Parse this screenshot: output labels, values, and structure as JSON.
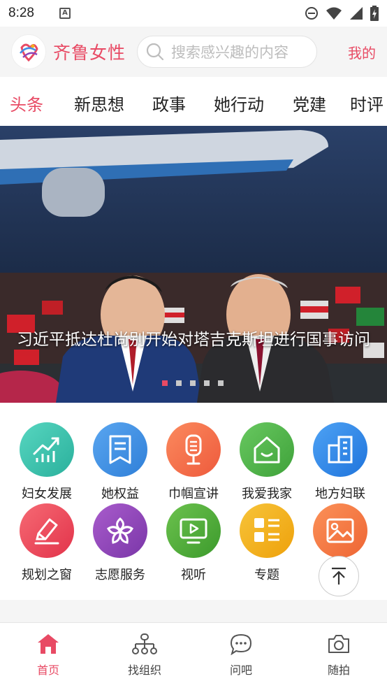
{
  "status_bar": {
    "time": "8:28",
    "notification_icon": "a-letter-icon",
    "right_icons": [
      "do-not-disturb-icon",
      "wifi-icon",
      "signal-icon",
      "battery-charging-icon"
    ]
  },
  "header": {
    "logo_icon": "qilu-women-logo",
    "brand": "齐鲁女性",
    "search_placeholder": "搜索感兴趣的内容",
    "mine_label": "我的"
  },
  "tabs": [
    {
      "label": "头条",
      "active": true
    },
    {
      "label": "新思想",
      "active": false
    },
    {
      "label": "政事",
      "active": false
    },
    {
      "label": "她行动",
      "active": false
    },
    {
      "label": "党建",
      "active": false
    },
    {
      "label": "时评",
      "active": false
    }
  ],
  "banner": {
    "caption": "习近平抵达杜尚别开始对塔吉克斯坦进行国事访问",
    "slide_count": 5,
    "active_slide": 1
  },
  "grid": [
    {
      "label": "妇女发展",
      "icon": "chart-growth-icon",
      "color": "#3cc6b0"
    },
    {
      "label": "她权益",
      "icon": "document-icon",
      "color": "#3f8fe6"
    },
    {
      "label": "巾帼宣讲",
      "icon": "microphone-icon",
      "color": "#f4734d"
    },
    {
      "label": "我爱我家",
      "icon": "home-icon",
      "color": "#52b84d"
    },
    {
      "label": "地方妇联",
      "icon": "building-icon",
      "color": "#2f84e8"
    },
    {
      "label": "规划之窗",
      "icon": "pen-edit-icon",
      "color": "#ee4e5e"
    },
    {
      "label": "志愿服务",
      "icon": "flower-icon",
      "color": "#8d45b8"
    },
    {
      "label": "视听",
      "icon": "video-play-icon",
      "color": "#55b53c"
    },
    {
      "label": "专题",
      "icon": "list-layout-icon",
      "color": "#f2b21d"
    },
    {
      "label": "",
      "icon": "picture-icon",
      "color": "#f37c45"
    }
  ],
  "bottom_nav": [
    {
      "label": "首页",
      "icon": "home-icon",
      "active": true
    },
    {
      "label": "找组织",
      "icon": "org-tree-icon",
      "active": false
    },
    {
      "label": "问吧",
      "icon": "chat-bubble-icon",
      "active": false
    },
    {
      "label": "随拍",
      "icon": "camera-icon",
      "active": false
    }
  ],
  "colors": {
    "accent": "#e84a64"
  }
}
